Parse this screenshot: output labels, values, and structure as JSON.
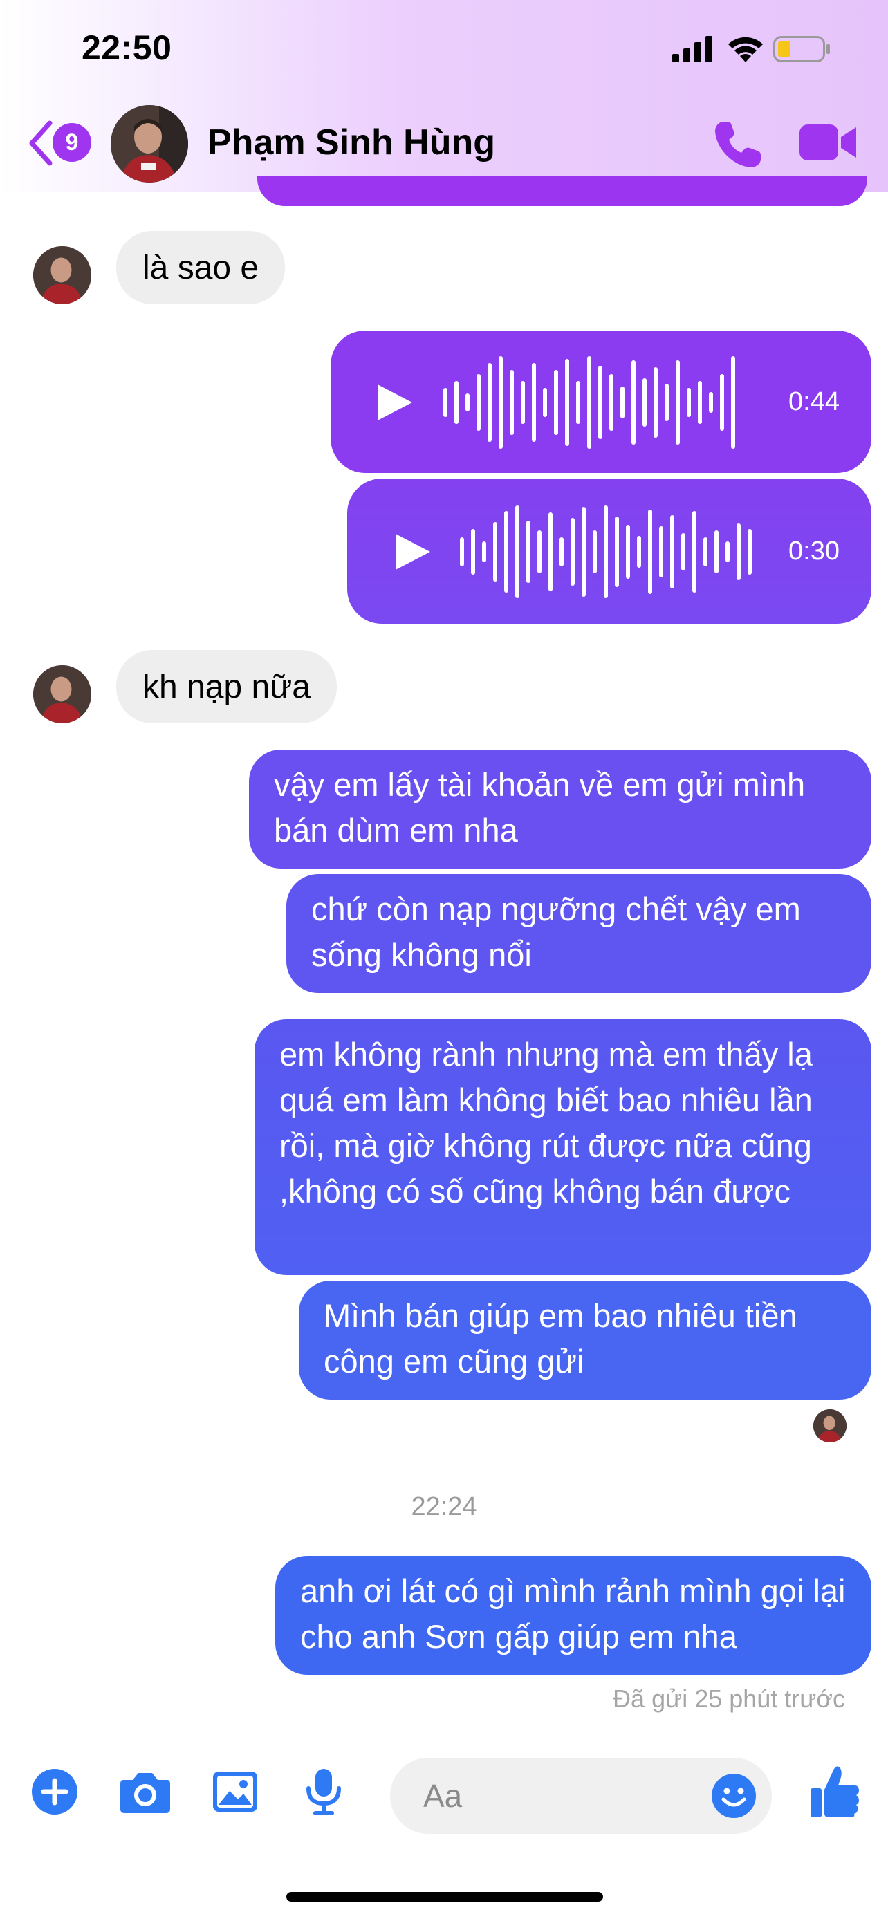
{
  "status_bar": {
    "time": "22:50"
  },
  "header": {
    "back_badge": "9",
    "contact_name": "Phạm Sinh Hùng"
  },
  "messages": {
    "in_1": "là sao e",
    "voice_1": "0:44",
    "voice_2": "0:30",
    "in_2": "kh nạp nữa",
    "out_1": "vậy em lấy tài khoản về em gửi mình bán dùm em nha",
    "out_2": "chứ còn nạp ngưỡng chết vậy em sống không nổi",
    "out_3": "em không rành nhưng mà em thấy lạ quá em làm không biết bao nhiêu lần rồi, mà giờ không rút được nữa cũng ,không có số cũng không bán được",
    "out_4": "Mình bán giúp em bao nhiêu tiền công em cũng gửi",
    "timestamp": "22:24",
    "out_5": "anh ơi lát có gì mình rảnh mình gọi lại cho anh Sơn gấp giúp em nha",
    "sent_status": "Đã gửi 25 phút trước"
  },
  "composer": {
    "placeholder": "Aa"
  },
  "colors": {
    "accent": "#a035f0",
    "bubble_top": "#8b3cf0",
    "bubble_bottom": "#3d66f2",
    "icon_blue": "#2e7af5"
  }
}
